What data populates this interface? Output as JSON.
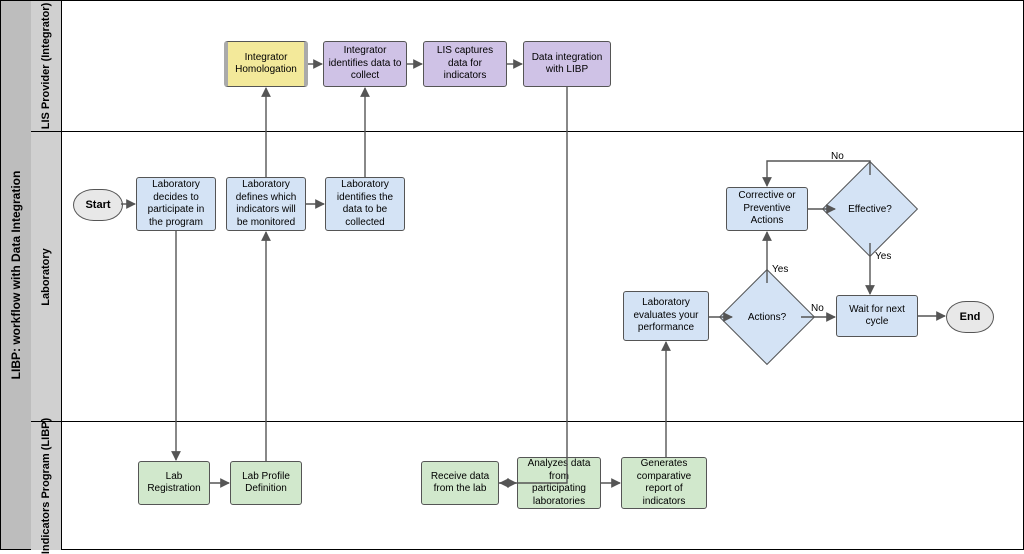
{
  "chart_data": {
    "type": "swimlane-flowchart",
    "title": "LIBP: workflow with Data Integration",
    "lanes": [
      {
        "id": "integrator",
        "label": "LIS Provider (Integrator)"
      },
      {
        "id": "laboratory",
        "label": "Laboratory"
      },
      {
        "id": "libp",
        "label": "Indicators Program (LIBP)"
      }
    ],
    "nodes": [
      {
        "id": "start",
        "lane": "laboratory",
        "type": "terminator",
        "label": "Start"
      },
      {
        "id": "decide",
        "lane": "laboratory",
        "type": "process",
        "label": "Laboratory decides to participate in the program"
      },
      {
        "id": "labreg",
        "lane": "libp",
        "type": "process",
        "label": "Lab Registration"
      },
      {
        "id": "profile",
        "lane": "libp",
        "type": "process",
        "label": "Lab Profile Definition"
      },
      {
        "id": "defineInd",
        "lane": "laboratory",
        "type": "process",
        "label": "Laboratory defines which indicators will be monitored"
      },
      {
        "id": "homolog",
        "lane": "integrator",
        "type": "process-highlight",
        "label": "Integrator Homologation"
      },
      {
        "id": "idData",
        "lane": "laboratory",
        "type": "process",
        "label": "Laboratory identifies the data to be collected"
      },
      {
        "id": "intIdData",
        "lane": "integrator",
        "type": "process",
        "label": "Integrator identifies data to collect"
      },
      {
        "id": "lisCapture",
        "lane": "integrator",
        "type": "process",
        "label": "LIS captures data for indicators"
      },
      {
        "id": "dataInt",
        "lane": "integrator",
        "type": "process",
        "label": "Data integration with LIBP"
      },
      {
        "id": "receive",
        "lane": "libp",
        "type": "process",
        "label": "Receive data from the lab"
      },
      {
        "id": "analyze",
        "lane": "libp",
        "type": "process",
        "label": "Analyzes data from participating laboratories"
      },
      {
        "id": "report",
        "lane": "libp",
        "type": "process",
        "label": "Generates comparative report of indicators"
      },
      {
        "id": "evaluate",
        "lane": "laboratory",
        "type": "process",
        "label": "Laboratory evaluates your performance"
      },
      {
        "id": "actionsQ",
        "lane": "laboratory",
        "type": "decision",
        "label": "Actions?"
      },
      {
        "id": "corrective",
        "lane": "laboratory",
        "type": "process",
        "label": "Corrective or Preventive Actions"
      },
      {
        "id": "effectiveQ",
        "lane": "laboratory",
        "type": "decision",
        "label": "Effective?"
      },
      {
        "id": "wait",
        "lane": "laboratory",
        "type": "process",
        "label": "Wait for next cycle"
      },
      {
        "id": "end",
        "lane": "laboratory",
        "type": "terminator",
        "label": "End"
      }
    ],
    "edges": [
      {
        "from": "start",
        "to": "decide"
      },
      {
        "from": "decide",
        "to": "labreg"
      },
      {
        "from": "labreg",
        "to": "profile"
      },
      {
        "from": "profile",
        "to": "defineInd"
      },
      {
        "from": "defineInd",
        "to": "homolog"
      },
      {
        "from": "defineInd",
        "to": "idData"
      },
      {
        "from": "homolog",
        "to": "intIdData"
      },
      {
        "from": "idData",
        "to": "intIdData"
      },
      {
        "from": "intIdData",
        "to": "lisCapture"
      },
      {
        "from": "lisCapture",
        "to": "dataInt"
      },
      {
        "from": "dataInt",
        "to": "receive"
      },
      {
        "from": "receive",
        "to": "analyze"
      },
      {
        "from": "analyze",
        "to": "report"
      },
      {
        "from": "report",
        "to": "evaluate"
      },
      {
        "from": "evaluate",
        "to": "actionsQ"
      },
      {
        "from": "actionsQ",
        "to": "corrective",
        "label": "Yes"
      },
      {
        "from": "actionsQ",
        "to": "wait",
        "label": "No"
      },
      {
        "from": "corrective",
        "to": "effectiveQ"
      },
      {
        "from": "effectiveQ",
        "to": "corrective",
        "label": "No"
      },
      {
        "from": "effectiveQ",
        "to": "wait",
        "label": "Yes"
      },
      {
        "from": "wait",
        "to": "end"
      }
    ]
  },
  "title": "LIBP: workflow with Data Integration",
  "lanes": {
    "integrator": "LIS Provider (Integrator)",
    "laboratory": "Laboratory",
    "libp": "Indicators Program (LIBP)"
  },
  "nodes": {
    "start": "Start",
    "decide": "Laboratory decides to participate in the program",
    "labreg": "Lab Registration",
    "profile": "Lab Profile Definition",
    "defineInd": "Laboratory defines which indicators will be monitored",
    "homolog": "Integrator Homologation",
    "idData": "Laboratory identifies the data to be collected",
    "intIdData": "Integrator identifies data to collect",
    "lisCapture": "LIS captures data for indicators",
    "dataInt": "Data integration with LIBP",
    "receive": "Receive data from the lab",
    "analyze": "Analyzes data from participating laboratories",
    "report": "Generates comparative report of indicators",
    "evaluate": "Laboratory evaluates your performance",
    "actionsQ": "Actions?",
    "corrective": "Corrective or Preventive Actions",
    "effectiveQ": "Effective?",
    "wait": "Wait for next cycle",
    "end": "End"
  },
  "edgeLabels": {
    "yes": "Yes",
    "no": "No"
  }
}
